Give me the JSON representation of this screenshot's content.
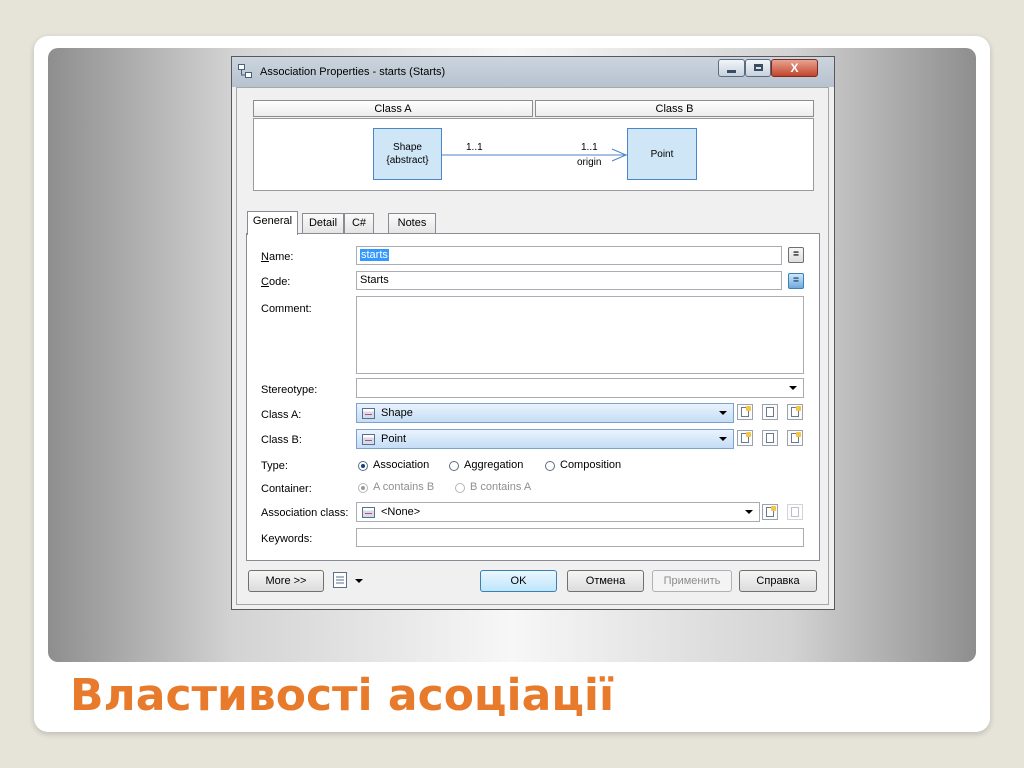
{
  "slide": {
    "title": "Властивості асоціації"
  },
  "window": {
    "title": "Association Properties - starts (Starts)",
    "buttons": {
      "minimize": "minimize",
      "maximize": "maximize",
      "close": "X"
    }
  },
  "preview": {
    "class_a_header": "Class A",
    "class_b_header": "Class B",
    "left_box_name": "Shape",
    "left_box_stereo": "{abstract}",
    "right_box_name": "Point",
    "left_mult": "1..1",
    "right_mult": "1..1",
    "role": "origin"
  },
  "tabs": [
    {
      "label": "General",
      "active": true
    },
    {
      "label": "Detail",
      "active": false
    },
    {
      "label": "C#",
      "active": false
    },
    {
      "label": "Notes",
      "active": false
    }
  ],
  "form": {
    "name_label": "Name:",
    "name_value": "starts",
    "code_label": "Code:",
    "code_value": "Starts",
    "comment_label": "Comment:",
    "comment_value": "",
    "stereotype_label": "Stereotype:",
    "stereotype_value": "",
    "class_a_label": "Class A:",
    "class_a_value": "Shape",
    "class_b_label": "Class B:",
    "class_b_value": "Point",
    "type_label": "Type:",
    "type_options": [
      {
        "label": "Association",
        "selected": true
      },
      {
        "label": "Aggregation",
        "selected": false
      },
      {
        "label": "Composition",
        "selected": false
      }
    ],
    "container_label": "Container:",
    "container_options": [
      {
        "label": "A contains B",
        "selected": true
      },
      {
        "label": "B contains A",
        "selected": false
      }
    ],
    "assoc_class_label": "Association class:",
    "assoc_class_value": "<None>",
    "keywords_label": "Keywords:",
    "keywords_value": "",
    "eq_button": "="
  },
  "buttons": {
    "more": "More >>",
    "ok": "OK",
    "cancel": "Отмена",
    "apply": "Применить",
    "help": "Справка"
  },
  "icons": {
    "window": "association-icon",
    "combo": "class-icon",
    "new": "new-object-icon",
    "properties": "properties-icon",
    "browse": "browse-icon",
    "layout": "layout-icon"
  },
  "colors": {
    "slide_title": "#e87a2c",
    "uml_fill": "#cfe6f7",
    "uml_border": "#4b86c6",
    "selection": "#3399ff"
  }
}
